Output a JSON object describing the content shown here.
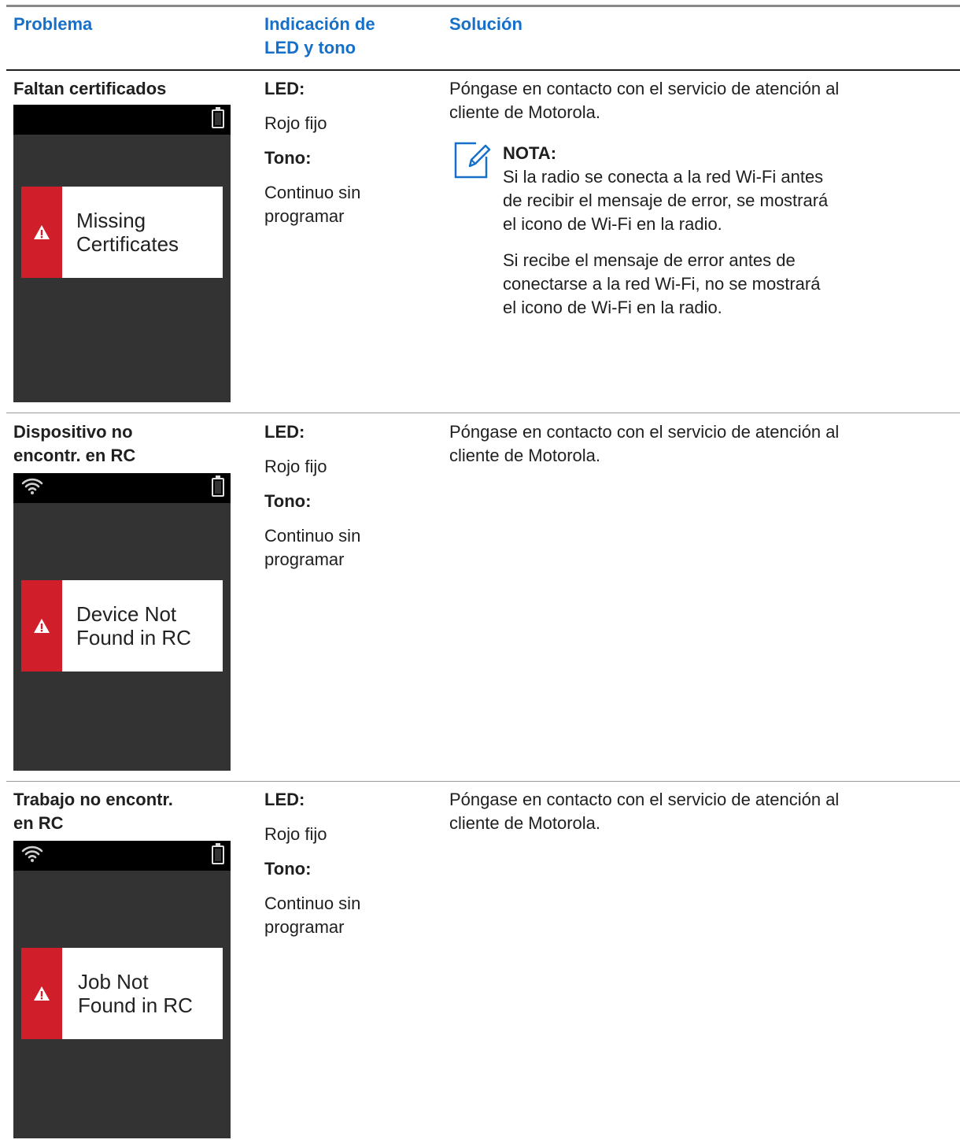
{
  "table": {
    "headers": {
      "problem": "Problema",
      "indication_line1": "Indicación de",
      "indication_line2": "LED y tono",
      "solution": "Solución"
    },
    "rows": [
      {
        "problem_line1": "Faltan certificados",
        "problem_line2": "",
        "screen": {
          "wifi": false,
          "message_line1": "Missing",
          "message_line2": "Certificates"
        },
        "led_label": "LED:",
        "led_value": "Rojo fijo",
        "tone_label": "Tono:",
        "tone_value_line1": "Continuo sin",
        "tone_value_line2": "programar",
        "solution_line1": "Póngase en contacto con el servicio de atención al",
        "solution_line2": "cliente de Motorola.",
        "note": {
          "title": "NOTA:",
          "p1_line1": "Si la radio se conecta a la red Wi-Fi antes",
          "p1_line2": "de recibir el mensaje de error, se mostrará",
          "p1_line3": "el icono de Wi-Fi en la radio.",
          "p2_line1": "Si recibe el mensaje de error antes de",
          "p2_line2": "conectarse a la red Wi-Fi, no se mostrará",
          "p2_line3": "el icono de Wi-Fi en la radio."
        }
      },
      {
        "problem_line1": "Dispositivo no",
        "problem_line2": "encontr. en RC",
        "screen": {
          "wifi": true,
          "message_line1": "Device Not",
          "message_line2": "Found in RC"
        },
        "led_label": "LED:",
        "led_value": "Rojo fijo",
        "tone_label": "Tono:",
        "tone_value_line1": "Continuo sin",
        "tone_value_line2": "programar",
        "solution_line1": "Póngase en contacto con el servicio de atención al",
        "solution_line2": "cliente de Motorola."
      },
      {
        "problem_line1": "Trabajo no encontr.",
        "problem_line2": "en RC",
        "screen": {
          "wifi": true,
          "message_line1": "Job Not",
          "message_line2": "Found in RC"
        },
        "led_label": "LED:",
        "led_value": "Rojo fijo",
        "tone_label": "Tono:",
        "tone_value_line1": "Continuo sin",
        "tone_value_line2": "programar",
        "solution_line1": "Póngase en contacto con el servicio de atención al",
        "solution_line2": "cliente de Motorola."
      }
    ]
  },
  "colors": {
    "header_text": "#1670c9",
    "screen_bg": "#333333",
    "status_bar": "#000000",
    "alert_red": "#d01f2b"
  },
  "icons": [
    "warning-icon",
    "battery-icon",
    "wifi-icon",
    "note-icon"
  ]
}
